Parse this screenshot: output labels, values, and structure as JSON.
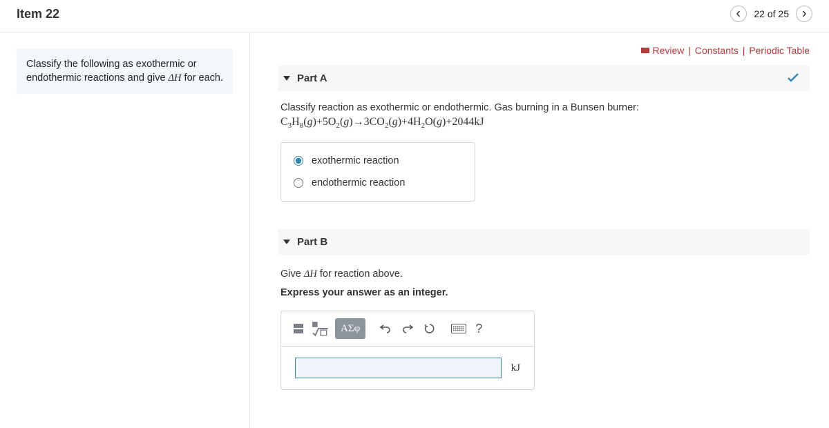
{
  "header": {
    "title": "Item 22",
    "position": "22 of 25"
  },
  "topLinks": {
    "review": "Review",
    "constants": "Constants",
    "periodic": "Periodic Table"
  },
  "instruction": {
    "prefix": "Classify the following as exothermic or endothermic reactions and give ",
    "delta": "ΔH",
    "suffix": " for each."
  },
  "partA": {
    "title": "Part A",
    "prompt": "Classify reaction as exothermic or endothermic. Gas burning in a Bunsen burner:",
    "options": {
      "exo": "exothermic reaction",
      "endo": "endothermic reaction"
    },
    "selected": "exo"
  },
  "partB": {
    "title": "Part B",
    "prompt_prefix": "Give ",
    "prompt_delta": "ΔH",
    "prompt_suffix": " for reaction above.",
    "instruction": "Express your answer as an integer.",
    "greek_label": "ΑΣφ",
    "unit": "kJ",
    "value": ""
  }
}
